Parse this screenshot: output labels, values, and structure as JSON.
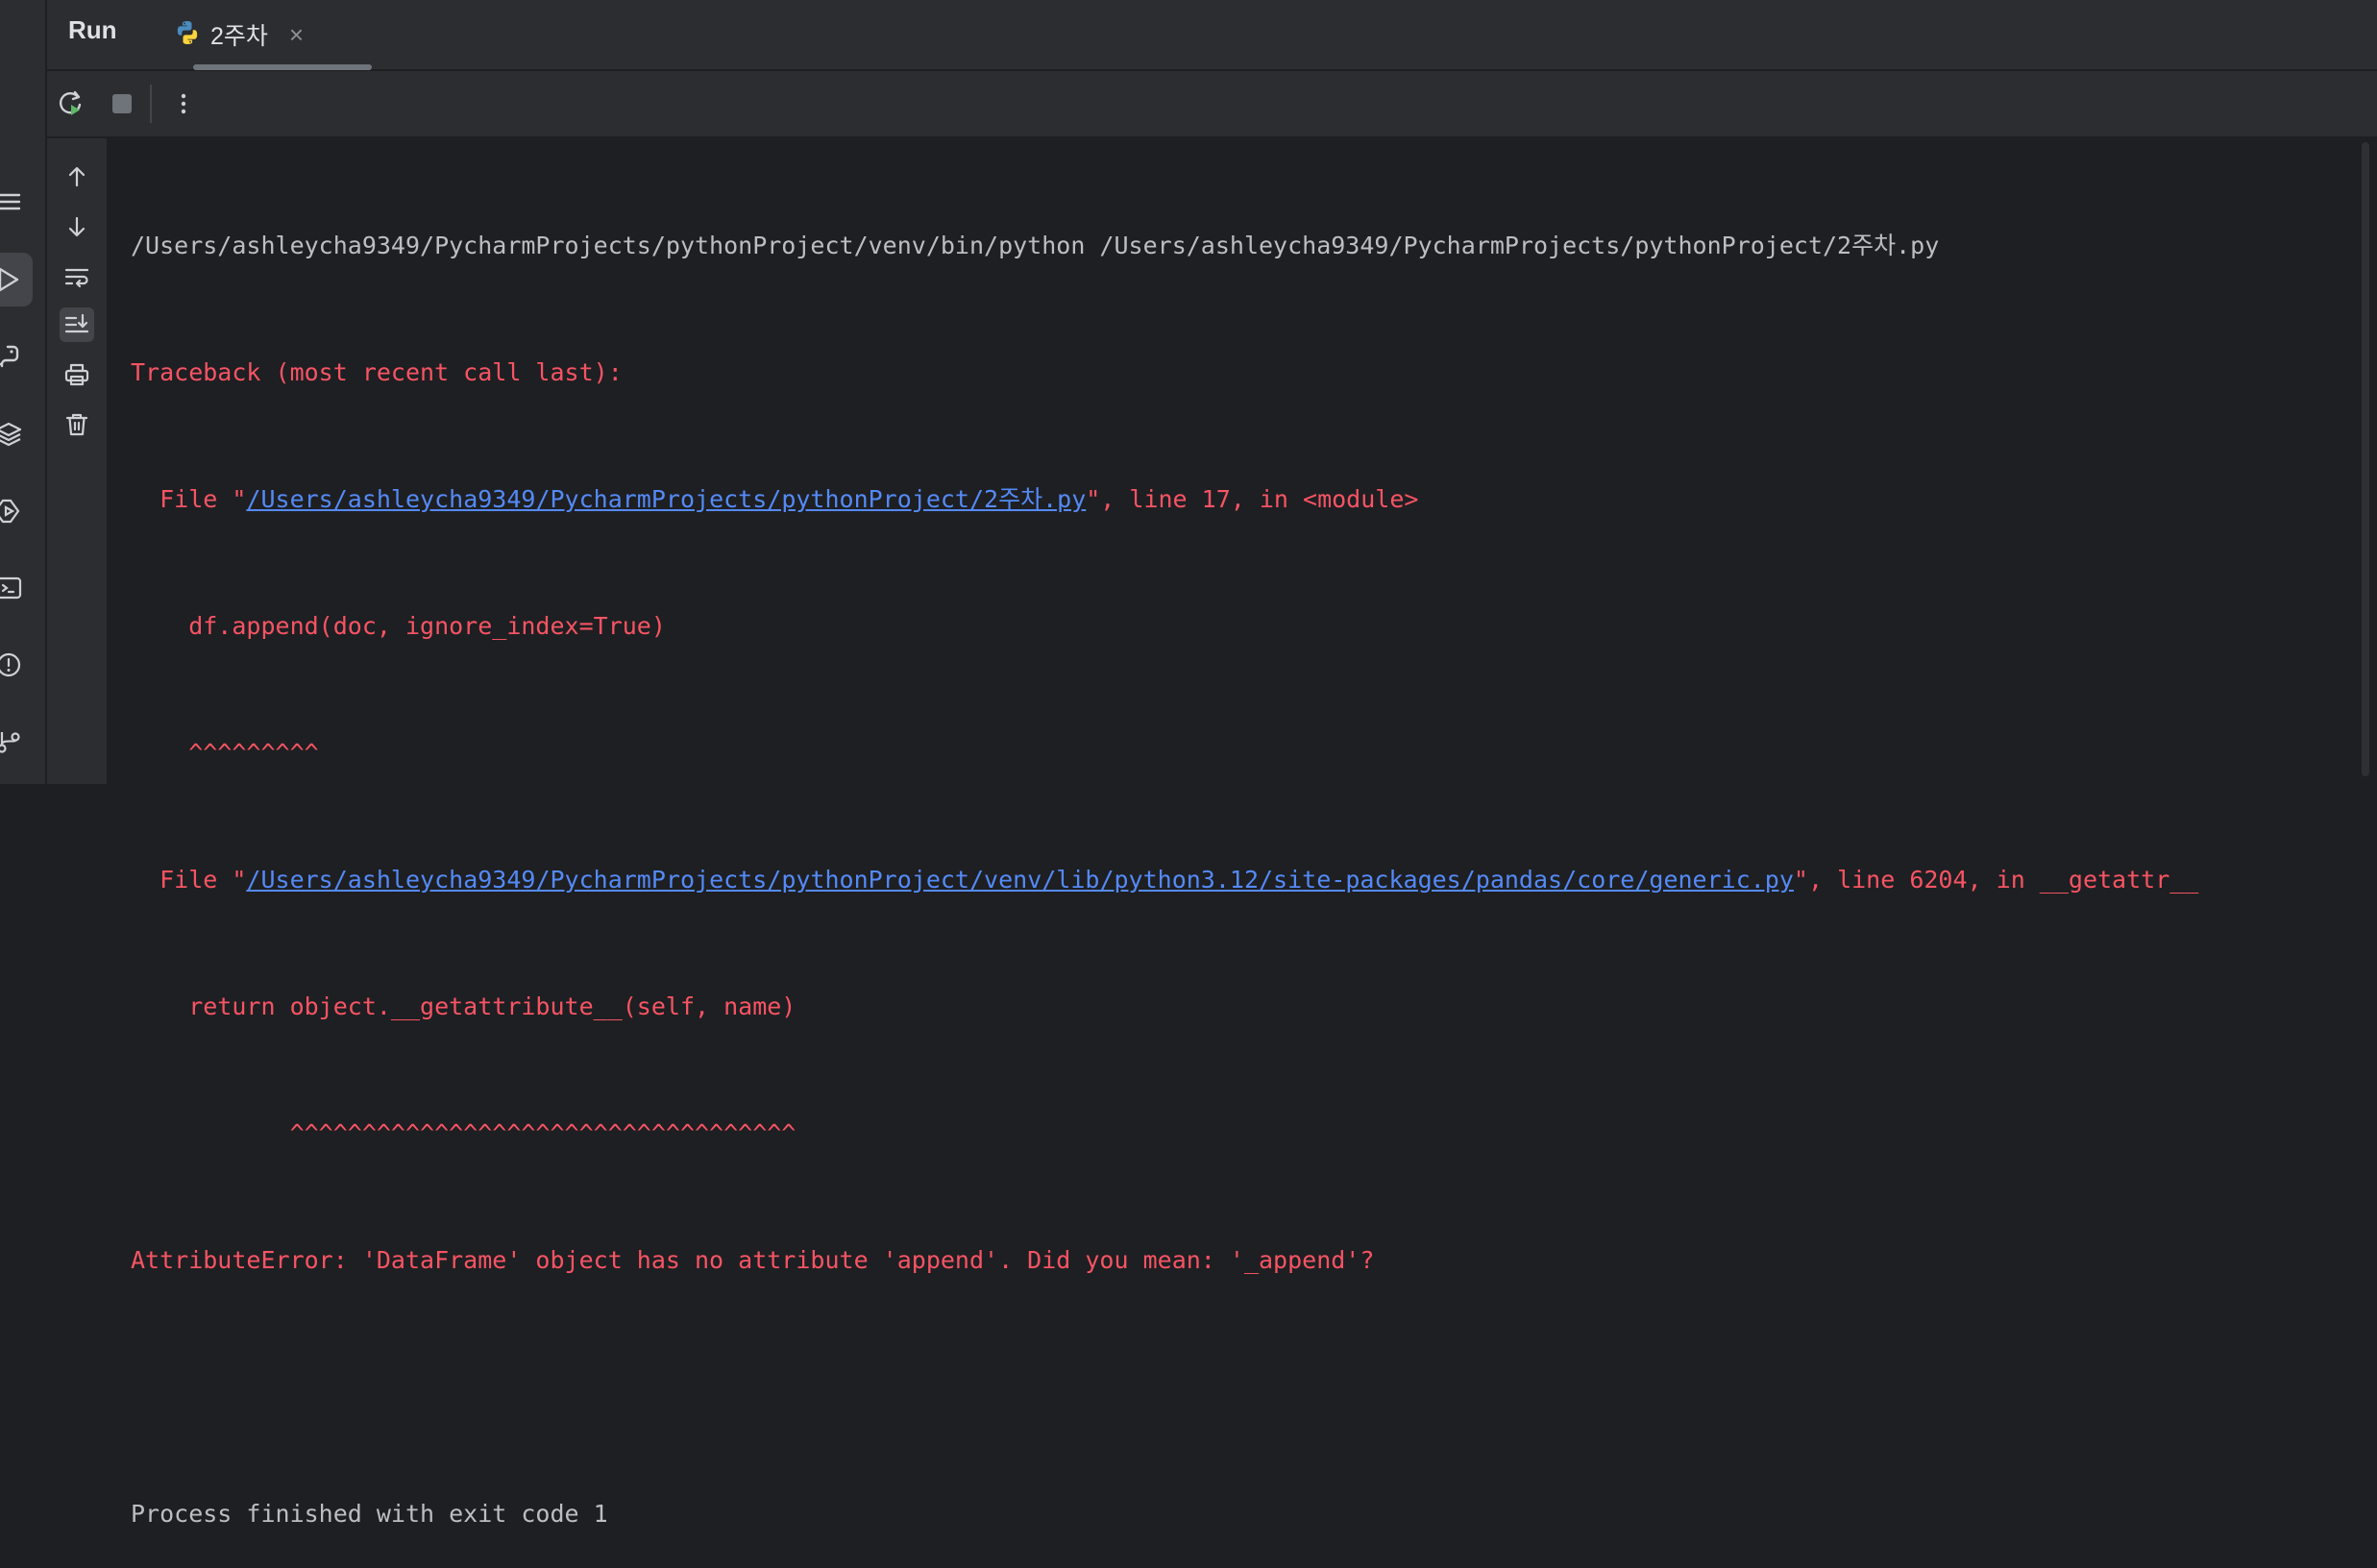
{
  "header": {
    "title": "Run",
    "tab": {
      "label": "2주차",
      "close": "×"
    }
  },
  "toolbar": {
    "rerun_icon": "rerun-icon",
    "stop_icon": "stop-icon",
    "more_icon": "more-vertical-icon"
  },
  "gutter": {
    "icons": [
      "arrow-up-icon",
      "arrow-down-icon",
      "soft-wrap-icon",
      "scroll-to-end-icon",
      "print-icon",
      "trash-icon"
    ]
  },
  "left_bar": {
    "icons": [
      "menu-icon",
      "run-icon",
      "python-packages-icon",
      "layers-icon",
      "services-icon",
      "terminal-icon",
      "problems-icon",
      "git-icon"
    ]
  },
  "console": {
    "cmd_line": "/Users/ashleycha9349/PycharmProjects/pythonProject/venv/bin/python /Users/ashleycha9349/PycharmProjects/pythonProject/2주차.py",
    "traceback_header": "Traceback (most recent call last):",
    "frame1": {
      "prefix": "  File \"",
      "path": "/Users/ashleycha9349/PycharmProjects/pythonProject/2주차.py",
      "suffix": "\", line 17, in <module>"
    },
    "frame1_code": "    df.append(doc, ignore_index=True)",
    "frame1_carets": "    ^^^^^^^^^",
    "frame2": {
      "prefix": "  File \"",
      "path": "/Users/ashleycha9349/PycharmProjects/pythonProject/venv/lib/python3.12/site-packages/pandas/core/generic.py",
      "suffix": "\", line 6204, in __getattr__"
    },
    "frame2_code": "    return object.__getattribute__(self, name)",
    "frame2_carets": "           ^^^^^^^^^^^^^^^^^^^^^^^^^^^^^^^^^^^",
    "error_line": "AttributeError: 'DataFrame' object has no attribute 'append'. Did you mean: '_append'?",
    "blank": "",
    "exit_line": "Process finished with exit code 1"
  },
  "colors": {
    "background": "#1e1f22",
    "panel": "#2b2d30",
    "error": "#f75464",
    "link": "#548af7",
    "text": "#bcbec4",
    "rerun_green": "#5fb865"
  }
}
